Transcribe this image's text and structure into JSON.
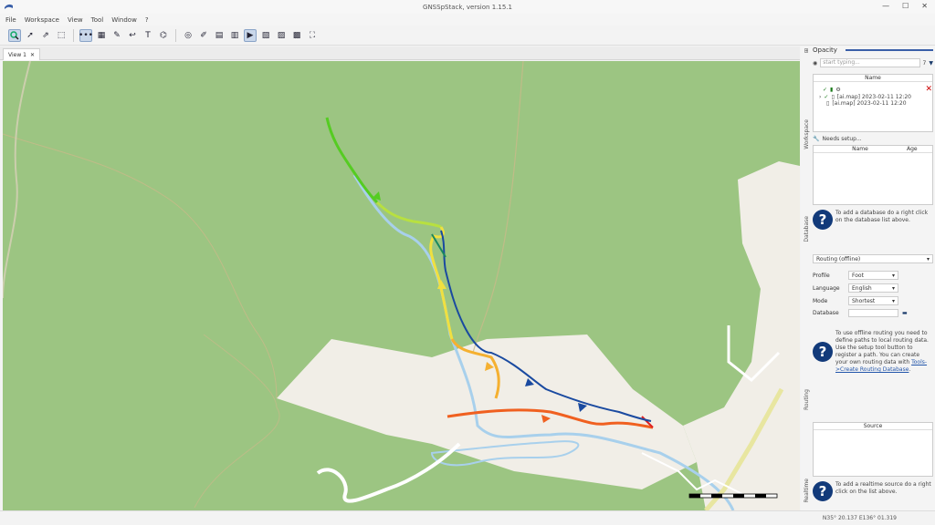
{
  "window": {
    "title": "GNSSpStack, version 1.15.1",
    "minimize": "—",
    "maximize": "☐",
    "close": "✕"
  },
  "menu": [
    "File",
    "Workspace",
    "View",
    "Tool",
    "Window",
    "?"
  ],
  "toolbar_icons": [
    "search-icon",
    "route-icon",
    "track-icon",
    "area-icon",
    "dots-icon",
    "grid-icon",
    "pen-icon",
    "curve-icon",
    "text-icon",
    "poly-icon",
    "circle-icon",
    "edit-icon",
    "doc-icon",
    "book-icon",
    "select-icon",
    "note-icon",
    "note-icon",
    "note-icon",
    "fullscreen-icon"
  ],
  "tabs": [
    {
      "label": "View 1",
      "close": "✕"
    }
  ],
  "map": {
    "bg": "#9cc582",
    "scale_label": "",
    "status_coords": "N35° 20.137 E136° 01.319"
  },
  "right_panel": {
    "geosearch": {
      "tab": "Opacity",
      "search_placeholder": "start typing...",
      "count": "7"
    },
    "workspace": {
      "tab_label": "Workspace",
      "col_name": "Name",
      "items": [
        {
          "label": "[ai.map] 2023-02-11 12:20"
        },
        {
          "label": "[ai.map] 2023-02-11 12:20"
        }
      ]
    },
    "database": {
      "tab_label": "Database",
      "setup": "Needs setup...",
      "col_name": "Name",
      "col_age": "Age",
      "help": "To add a database do a right click on the database list above."
    },
    "routing": {
      "tab_label": "Routing",
      "engine": "Routing (offline)",
      "profile_label": "Profile",
      "profile_value": "Foot",
      "language_label": "Language",
      "language_value": "English",
      "mode_label": "Mode",
      "mode_value": "Shortest",
      "database_label": "Database",
      "help_pre": "To use offline routing you need to define paths to local routing data. Use the setup tool button to register a path. You can create your own routing data with ",
      "help_link": "Tools->Create Routing Database",
      "help_post": "."
    },
    "realtime": {
      "tab_label": "Realtime",
      "col_source": "Source",
      "help": "To add a realtime source do a right click on the list above."
    }
  }
}
